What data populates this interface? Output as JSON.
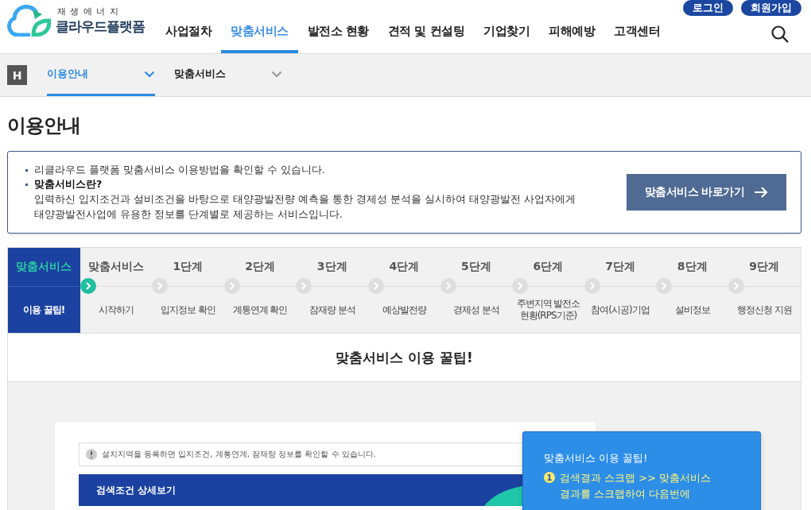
{
  "header": {
    "logo_tagline": "재 생 에 너 지",
    "logo_name": "클라우드플랫폼",
    "auth_buttons": [
      "로그인",
      "회원가입"
    ],
    "nav": [
      {
        "label": "사업절차",
        "selected": false
      },
      {
        "label": "맞춤서비스",
        "selected": true
      },
      {
        "label": "발전소 현황",
        "selected": false
      },
      {
        "label": "견적 및 컨설팅",
        "selected": false
      },
      {
        "label": "기업찾기",
        "selected": false
      },
      {
        "label": "피해예방",
        "selected": false
      },
      {
        "label": "고객센터",
        "selected": false
      }
    ]
  },
  "breadcrumb": {
    "home": "H",
    "items": [
      {
        "label": "이용안내",
        "selected": true
      },
      {
        "label": "맞춤서비스",
        "selected": false
      }
    ]
  },
  "page_title": "이용안내",
  "info": {
    "bullets": [
      {
        "text": "리클라우드 플랫폼 맞춤서비스 이용방법을 확인할 수 있습니다.",
        "bold": false
      },
      {
        "text": "맞춤서비스란?",
        "bold": true
      }
    ],
    "description": "입력하신 입지조건과 설비조건을 바탕으로 태양광발전량 예측을 통한 경제성 분석을 실시하여 태양광발전 사업자에게 태양광발전사업에 유용한 정보를 단계별로 제공하는 서비스입니다.",
    "button": "맞춤서비스 바로가기"
  },
  "steps": [
    {
      "stage": "맞춤서비스",
      "label": "이용 꿀팁!",
      "selected": true
    },
    {
      "stage": "맞춤서비스",
      "label": "시작하기",
      "selected": false
    },
    {
      "stage": "1단계",
      "label": "입지정보 확인",
      "selected": false
    },
    {
      "stage": "2단계",
      "label": "계통연계 확인",
      "selected": false
    },
    {
      "stage": "3단계",
      "label": "잠재량 분석",
      "selected": false
    },
    {
      "stage": "4단계",
      "label": "예상발전량",
      "selected": false
    },
    {
      "stage": "5단계",
      "label": "경제성 분석",
      "selected": false
    },
    {
      "stage": "6단계",
      "label": "주변지역 발전소 현황(RPS기준)",
      "selected": false
    },
    {
      "stage": "7단계",
      "label": "참여(시공)기업",
      "selected": false
    },
    {
      "stage": "8단계",
      "label": "설비정보",
      "selected": false
    },
    {
      "stage": "9단계",
      "label": "행정신청 지원",
      "selected": false
    }
  ],
  "section_title": "맞춤서비스 이용 꿀팁!",
  "preview": {
    "notice": "설치지역을 등록하면 입지조건, 계통연계, 잠재량 정보를 확인할 수 있습니다.",
    "panel_title": "검색조건 상세보기"
  },
  "tip": {
    "title": "맞춤서비스 이용 꿀팁!",
    "items": [
      {
        "number": "1",
        "text": "검색결과 스크랩 >> 맞춤서비스 결과를 스크랩하여 다음번에"
      }
    ]
  }
}
